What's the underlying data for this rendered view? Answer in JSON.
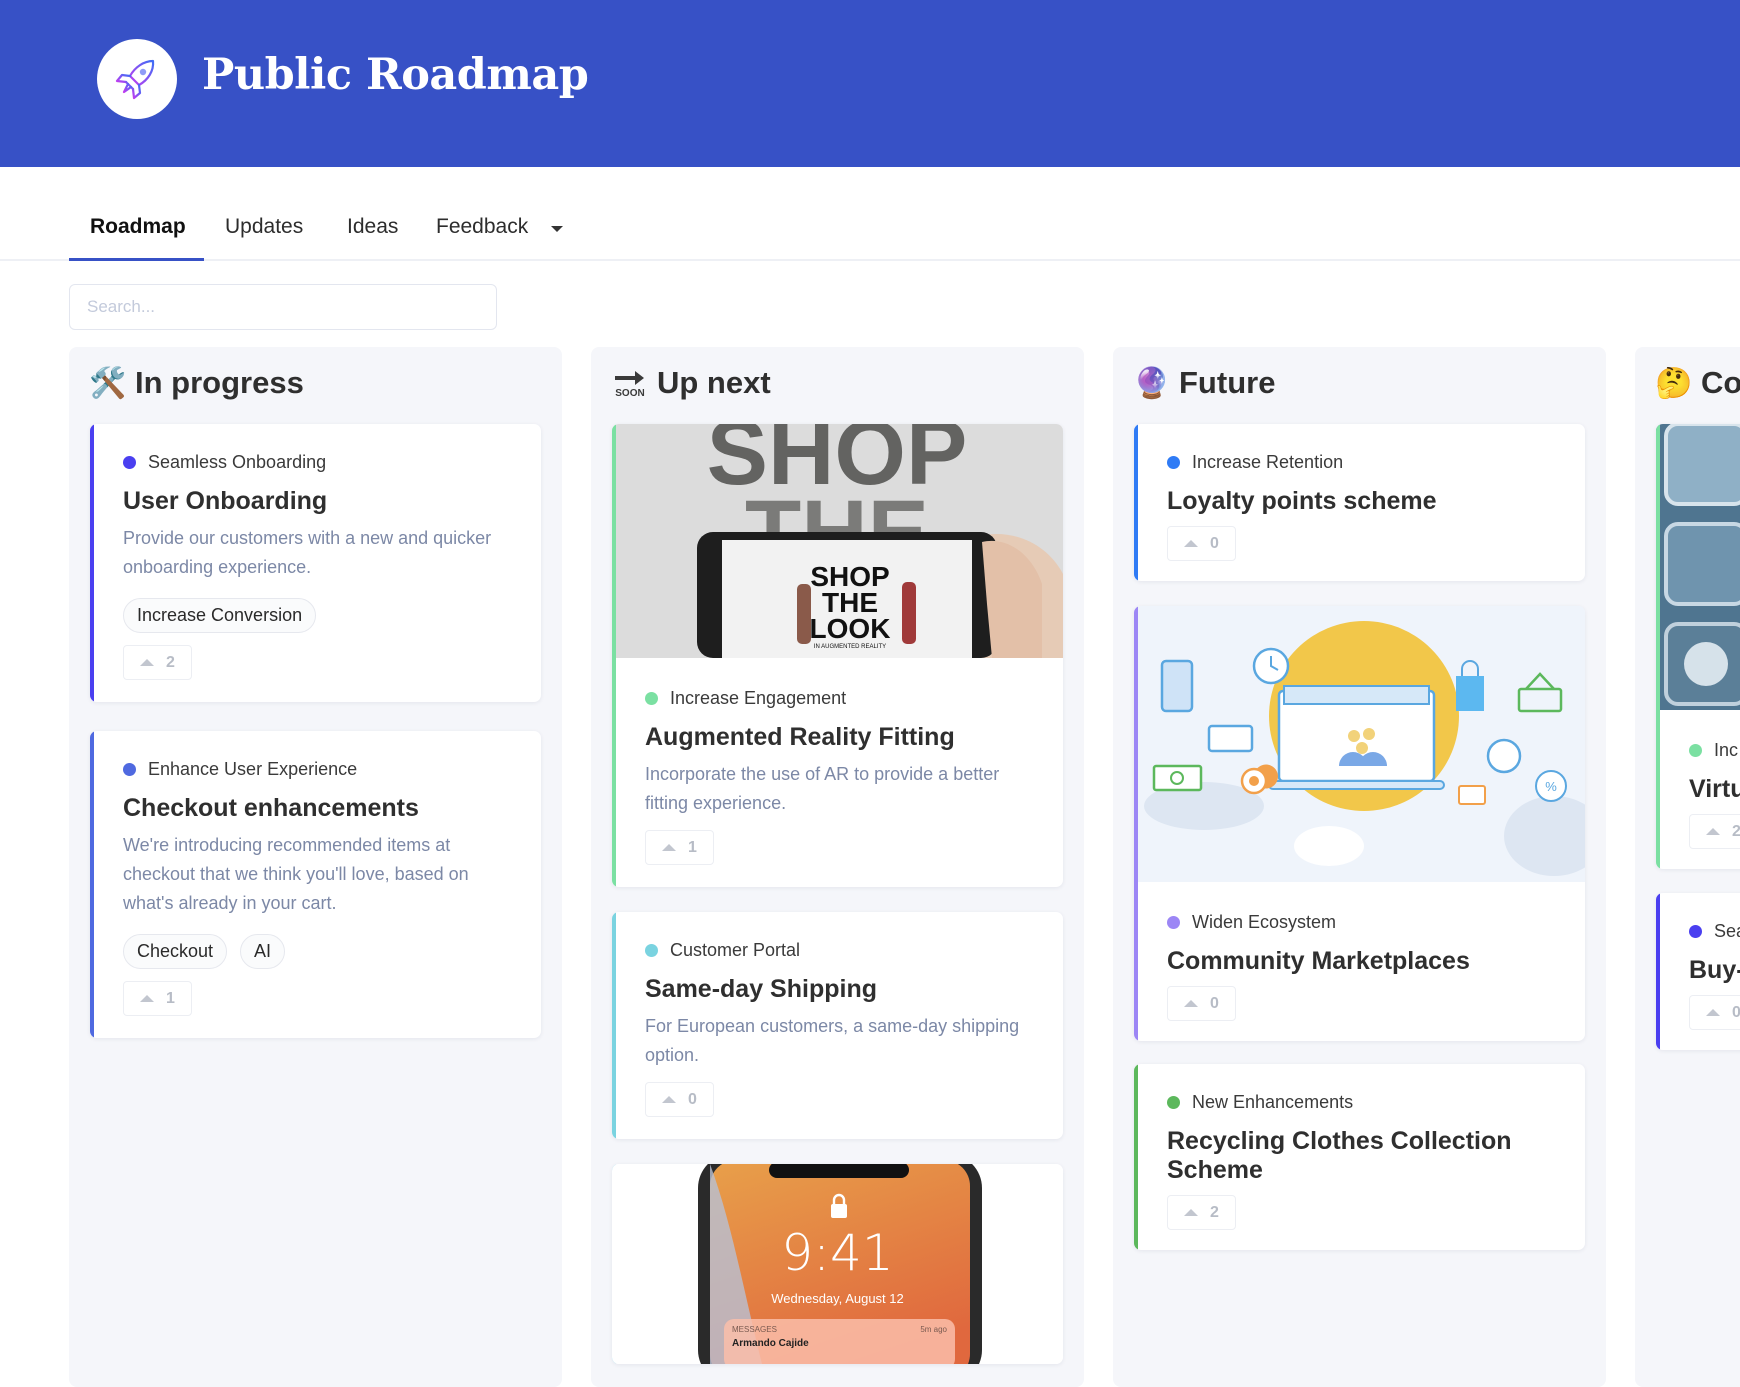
{
  "header": {
    "title": "Public Roadmap",
    "logo_icon": "rocket-icon",
    "background_color": "#3751c6"
  },
  "tabs": [
    {
      "label": "Roadmap",
      "active": true
    },
    {
      "label": "Updates",
      "active": false
    },
    {
      "label": "Ideas",
      "active": false
    },
    {
      "label": "Feedback",
      "active": false,
      "has_dropdown": true
    }
  ],
  "search": {
    "placeholder": "Search...",
    "value": ""
  },
  "columns": [
    {
      "title": "In progress",
      "emoji": "🛠️",
      "cards": [
        {
          "goal": "Seamless Onboarding",
          "goal_color": "#4a3ff0",
          "accent": "#4a3ff0",
          "title": "User Onboarding",
          "description": "Provide our customers with a new and quicker onboarding experience.",
          "tags": [
            "Increase Conversion"
          ],
          "votes": "2"
        },
        {
          "goal": "Enhance User Experience",
          "goal_color": "#4f69e0",
          "accent": "#4f69e0",
          "title": "Checkout enhancements",
          "description": "We're introducing recommended items at checkout that we think you'll love, based on what's already in your cart.",
          "tags": [
            "Checkout",
            "AI"
          ],
          "votes": "1"
        }
      ]
    },
    {
      "title": "Up next",
      "emoji": "🔜",
      "cards": [
        {
          "image": "shop-the-look-ar-photo",
          "image_text": [
            "SHOP",
            "THE",
            "LOOK",
            "IN AUGMENTED REALITY"
          ],
          "goal": "Increase Engagement",
          "goal_color": "#7be0a2",
          "accent": "#7be0a2",
          "title": "Augmented Reality Fitting",
          "description": "Incorporate the use of AR to provide a better fitting experience.",
          "votes": "1"
        },
        {
          "goal": "Customer Portal",
          "goal_color": "#7ad3e0",
          "accent": "#7ad3e0",
          "title": "Same-day Shipping",
          "description": "For European customers, a same-day shipping option.",
          "votes": "0"
        },
        {
          "image": "phone-lock-screen-photo",
          "accent": "#5fd0f0",
          "image_text": {
            "time": "9:41",
            "date": "Wednesday, August 12",
            "notif_app": "MESSAGES",
            "notif_time": "5m ago",
            "notif_sender": "Armando Cajide"
          }
        }
      ]
    },
    {
      "title": "Future",
      "emoji": "🔮",
      "cards": [
        {
          "goal": "Increase Retention",
          "goal_color": "#2f7bf5",
          "accent": "#2f7bf5",
          "title": "Loyalty points scheme",
          "votes": "0"
        },
        {
          "image": "online-marketplace-illustration",
          "goal": "Widen Ecosystem",
          "goal_color": "#9c86f5",
          "accent": "#9c86f5",
          "title": "Community Marketplaces",
          "votes": "0"
        },
        {
          "goal": "New Enhancements",
          "goal_color": "#5cb85c",
          "accent": "#5cb85c",
          "title": "Recycling Clothes Collection Scheme",
          "votes": "2"
        }
      ]
    },
    {
      "title": "Co",
      "emoji": "🤔",
      "cards": [
        {
          "image": "keyboard-keys-photo",
          "goal": "Inc",
          "goal_color": "#7be0a2",
          "accent": "#7be0a2",
          "title": "Virtu",
          "votes": "2"
        },
        {
          "goal": "Sea",
          "goal_color": "#4a3ff0",
          "accent": "#4a3ff0",
          "title": "Buy-",
          "votes": "0"
        }
      ]
    }
  ]
}
